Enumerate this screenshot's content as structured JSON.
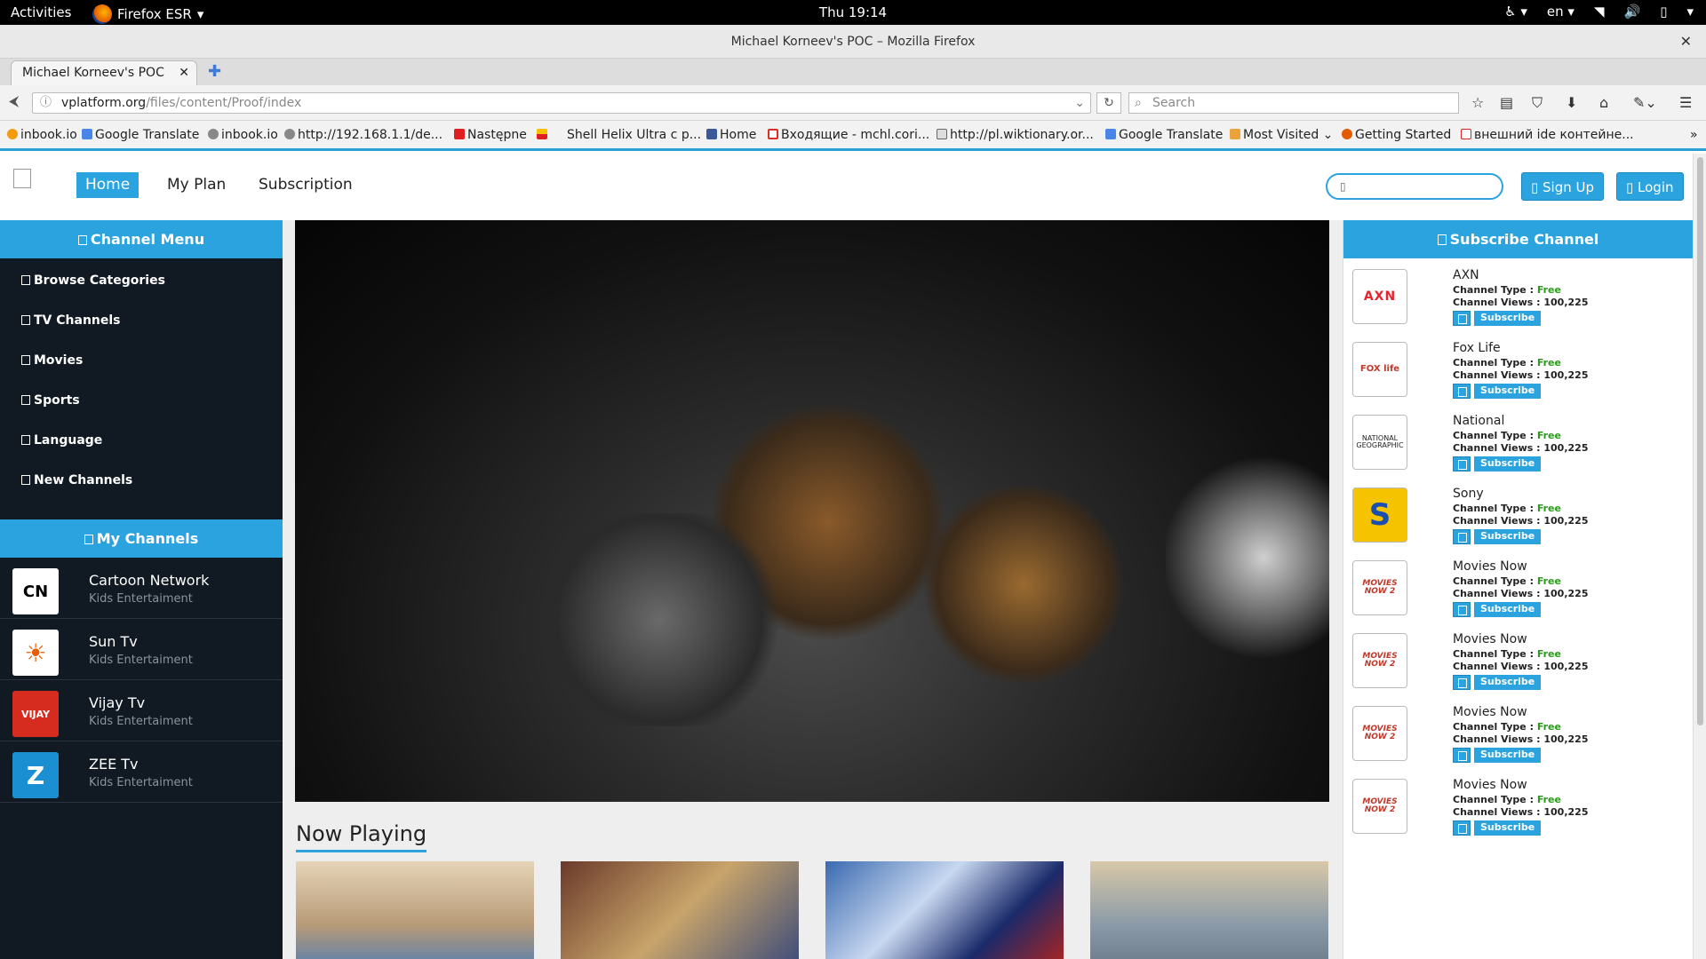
{
  "system": {
    "activities": "Activities",
    "app": "Firefox ESR",
    "clock": "Thu 19:14",
    "lang": "en"
  },
  "window": {
    "title": "Michael Korneev's POC – Mozilla Firefox"
  },
  "tab": {
    "label": "Michael Korneev's POC"
  },
  "urlbar": {
    "domain": "vplatform.org",
    "path": "/files/content/Proof/index",
    "search_placeholder": "Search"
  },
  "bookmarks": [
    "inbook.io",
    "Google Translate",
    "inbook.io",
    "http://192.168.1.1/de...",
    "Następne",
    "",
    "Shell Helix Ultra с р...",
    "Home",
    "Входящие - mchl.cori...",
    "http://pl.wiktionary.or...",
    "Google Translate",
    "Most Visited",
    "Getting Started",
    "внешний ide контейне..."
  ],
  "header": {
    "nav": [
      "Home",
      "My Plan",
      "Subscription"
    ],
    "signup": "Sign Up",
    "login": "Login"
  },
  "left": {
    "channel_menu_title": "Channel Menu",
    "menu": [
      "Browse Categories",
      "TV Channels",
      "Movies",
      "Sports",
      "Language",
      "New Channels"
    ],
    "my_channels_title": "My Channels",
    "channels": [
      {
        "name": "Cartoon Network",
        "genre": "Kids Entertaiment",
        "logo": "CN"
      },
      {
        "name": "Sun Tv",
        "genre": "Kids Entertaiment",
        "logo": "☀"
      },
      {
        "name": "Vijay Tv",
        "genre": "Kids Entertaiment",
        "logo": "VIJAY"
      },
      {
        "name": "ZEE Tv",
        "genre": "Kids Entertaiment",
        "logo": "Z"
      }
    ]
  },
  "now_playing": "Now Playing",
  "right": {
    "title": "Subscribe Channel",
    "type_label": "Channel Type : ",
    "views_label": "Channel Views : ",
    "subscribe": "Subscribe",
    "channels": [
      {
        "name": "AXN",
        "type": "Free",
        "views": "100,225",
        "logo": "AXN"
      },
      {
        "name": "Fox Life",
        "type": "Free",
        "views": "100,225",
        "logo": "FOX life"
      },
      {
        "name": "National",
        "type": "Free",
        "views": "100,225",
        "logo": "NATIONAL GEOGRAPHIC"
      },
      {
        "name": "Sony",
        "type": "Free",
        "views": "100,225",
        "logo": "S"
      },
      {
        "name": "Movies Now",
        "type": "Free",
        "views": "100,225",
        "logo": "MOVIES NOW 2"
      },
      {
        "name": "Movies Now",
        "type": "Free",
        "views": "100,225",
        "logo": "MOVIES NOW 2"
      },
      {
        "name": "Movies Now",
        "type": "Free",
        "views": "100,225",
        "logo": "MOVIES NOW 2"
      },
      {
        "name": "Movies Now",
        "type": "Free",
        "views": "100,225",
        "logo": "MOVIES NOW 2"
      }
    ]
  },
  "colors": {
    "accent": "#2aa3df",
    "sidebar": "#111a22",
    "free": "#2a9b1a"
  }
}
